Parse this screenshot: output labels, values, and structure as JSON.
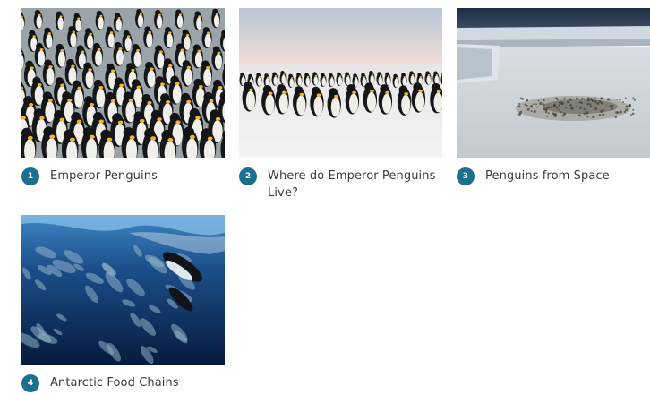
{
  "theme": {
    "badge_color": "#1c6f8f",
    "text_color": "#3b3b3b"
  },
  "gallery": {
    "items": [
      {
        "number": "1",
        "title": "Emperor Penguins",
        "image": "emperor-penguin-colony-photo"
      },
      {
        "number": "2",
        "title": "Where do Emperor Penguins Live?",
        "image": "penguins-on-ice-photo"
      },
      {
        "number": "3",
        "title": "Penguins from Space",
        "image": "antarctic-ice-shelf-photo"
      },
      {
        "number": "4",
        "title": "Antarctic Food Chains",
        "image": "penguins-swimming-underwater-photo"
      }
    ]
  }
}
